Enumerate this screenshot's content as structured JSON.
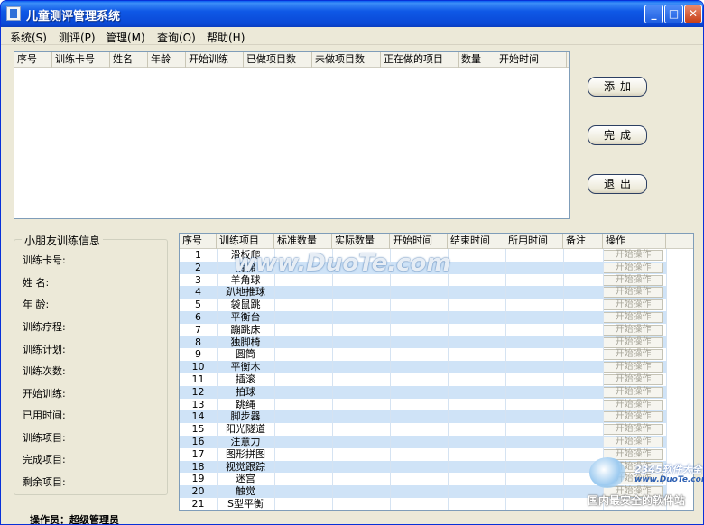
{
  "window": {
    "title": "儿童测评管理系统",
    "minimize": "_",
    "maximize": "□",
    "close": "✕"
  },
  "menu": [
    "系统(S)",
    "测评(P)",
    "管理(M)",
    "查询(O)",
    "帮助(H)"
  ],
  "top_table": {
    "columns": [
      "序号",
      "训练卡号",
      "姓名",
      "年龄",
      "开始训练",
      "已做项目数",
      "未做项目数",
      "正在做的项目",
      "数量",
      "开始时间"
    ]
  },
  "actions": {
    "add": "添加",
    "complete": "完成",
    "exit": "退出"
  },
  "info_panel": {
    "title": "小朋友训练信息",
    "labels": [
      "训练卡号:",
      "姓    名:",
      "年    龄:",
      "训练疗程:",
      "训练计划:",
      "训练次数:",
      "开始训练:",
      "已用时间:",
      "训练项目:",
      "完成项目:",
      "剩余项目:"
    ]
  },
  "item_table": {
    "columns": [
      "序号",
      "训练项目",
      "标准数量",
      "实际数量",
      "开始时间",
      "结束时间",
      "所用时间",
      "备注",
      "操作"
    ],
    "op_label": "开始操作",
    "rows": [
      {
        "no": "1",
        "item": "滑板爬"
      },
      {
        "no": "2",
        "item": "滑梯"
      },
      {
        "no": "3",
        "item": "羊角球"
      },
      {
        "no": "4",
        "item": "趴地推球"
      },
      {
        "no": "5",
        "item": "袋鼠跳"
      },
      {
        "no": "6",
        "item": "平衡台"
      },
      {
        "no": "7",
        "item": "蹦跳床"
      },
      {
        "no": "8",
        "item": "独脚椅"
      },
      {
        "no": "9",
        "item": "圆筒"
      },
      {
        "no": "10",
        "item": "平衡木"
      },
      {
        "no": "11",
        "item": "插滚"
      },
      {
        "no": "12",
        "item": "拍球"
      },
      {
        "no": "13",
        "item": "跳绳"
      },
      {
        "no": "14",
        "item": "脚步器"
      },
      {
        "no": "15",
        "item": "阳光隧道"
      },
      {
        "no": "16",
        "item": "注意力"
      },
      {
        "no": "17",
        "item": "图形拼图"
      },
      {
        "no": "18",
        "item": "视觉跟踪"
      },
      {
        "no": "19",
        "item": "迷宫"
      },
      {
        "no": "20",
        "item": "触觉"
      },
      {
        "no": "21",
        "item": "S型平衡"
      }
    ]
  },
  "status": {
    "operator": "操作员：超级管理员"
  },
  "watermarks": {
    "center": "www.DuoTe.com",
    "corner_brand": "2345软件大全",
    "corner_url": "www.DuoTe.com",
    "corner_caption": "国内最安全的软件站"
  }
}
